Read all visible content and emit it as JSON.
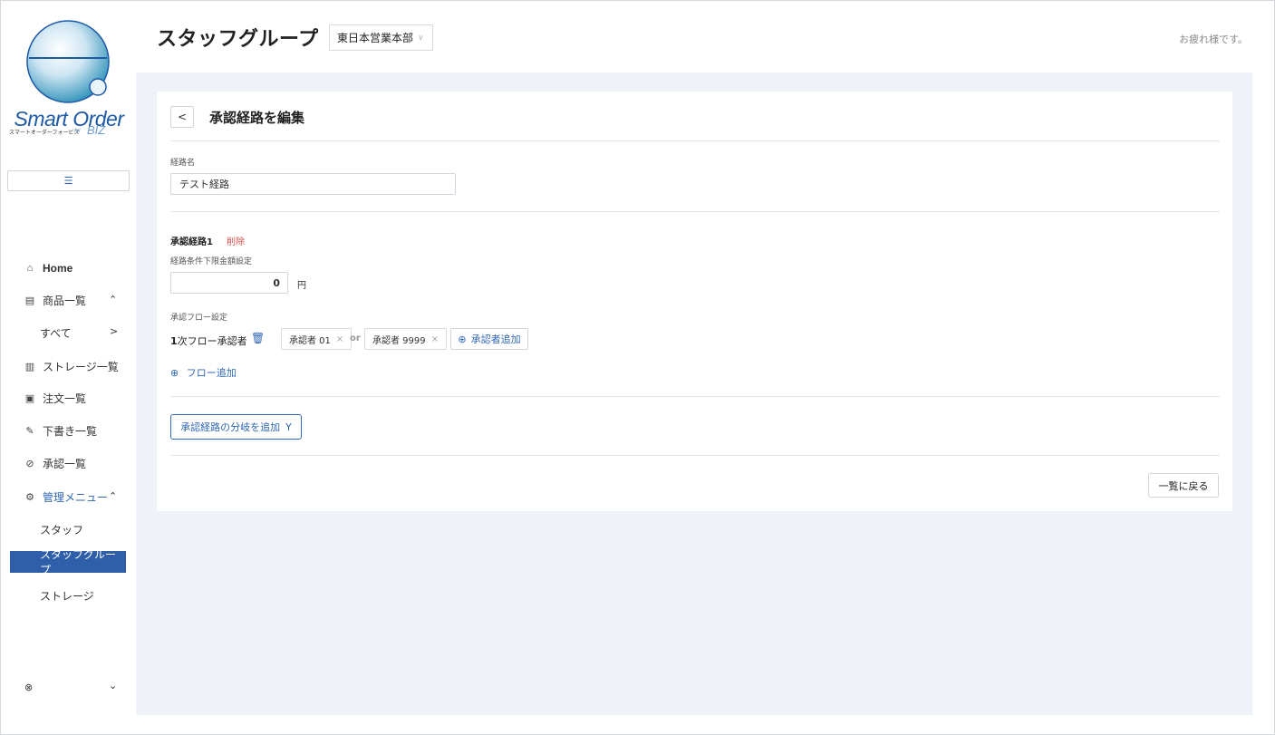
{
  "app": {
    "logo_text": "Smart Order",
    "logo_subtext": "スマートオーダーフォービズ",
    "logo_for": "for",
    "logo_biz": "BIZ",
    "menu_toggle_icon": "list-icon"
  },
  "header": {
    "title": "スタッフグループ",
    "department": "東日本営業本部",
    "greeting": "お疲れ様です。"
  },
  "sidebar": {
    "items": [
      {
        "label": "Home",
        "icon": "home-icon"
      },
      {
        "label": "商品一覧",
        "icon": "product-icon",
        "arrow": "^"
      },
      {
        "label": "すべて",
        "arrow": ">"
      },
      {
        "label": "ストレージ一覧",
        "icon": "storage-icon"
      },
      {
        "label": "注文一覧",
        "icon": "order-icon"
      },
      {
        "label": "下書き一覧",
        "icon": "draft-icon"
      },
      {
        "label": "承認一覧",
        "icon": "approve-icon"
      },
      {
        "label": "管理メニュー",
        "icon": "admin-icon",
        "arrow": "^"
      },
      {
        "label": "スタッフ"
      },
      {
        "label": "スタッフグループ",
        "active": true
      },
      {
        "label": "ストレージ"
      }
    ]
  },
  "card": {
    "back_label": "<",
    "title": "承認経路を編集",
    "route_name_label": "経路名",
    "route_name_value": "テスト経路",
    "route_title": "承認経路1",
    "route_delete": "削除",
    "min_amount_label": "経路条件下限金額設定",
    "min_amount_value": "0",
    "currency": "円",
    "flow_setting_label": "承認フロー設定",
    "flow_label_prefix": "1",
    "flow_label": "次フロー承認者",
    "approvers": [
      "承認者 01",
      "承認者 9999"
    ],
    "or_text": "or",
    "add_approver": "承認者追加",
    "add_flow": "フロー追加",
    "add_branch": "承認経路の分岐を追加",
    "back_to_list": "一覧に戻る"
  },
  "colors": {
    "accent": "#2f66b3",
    "active_nav": "#2f5fa8",
    "danger": "#d9534f",
    "main_bg": "#eff3f9"
  }
}
